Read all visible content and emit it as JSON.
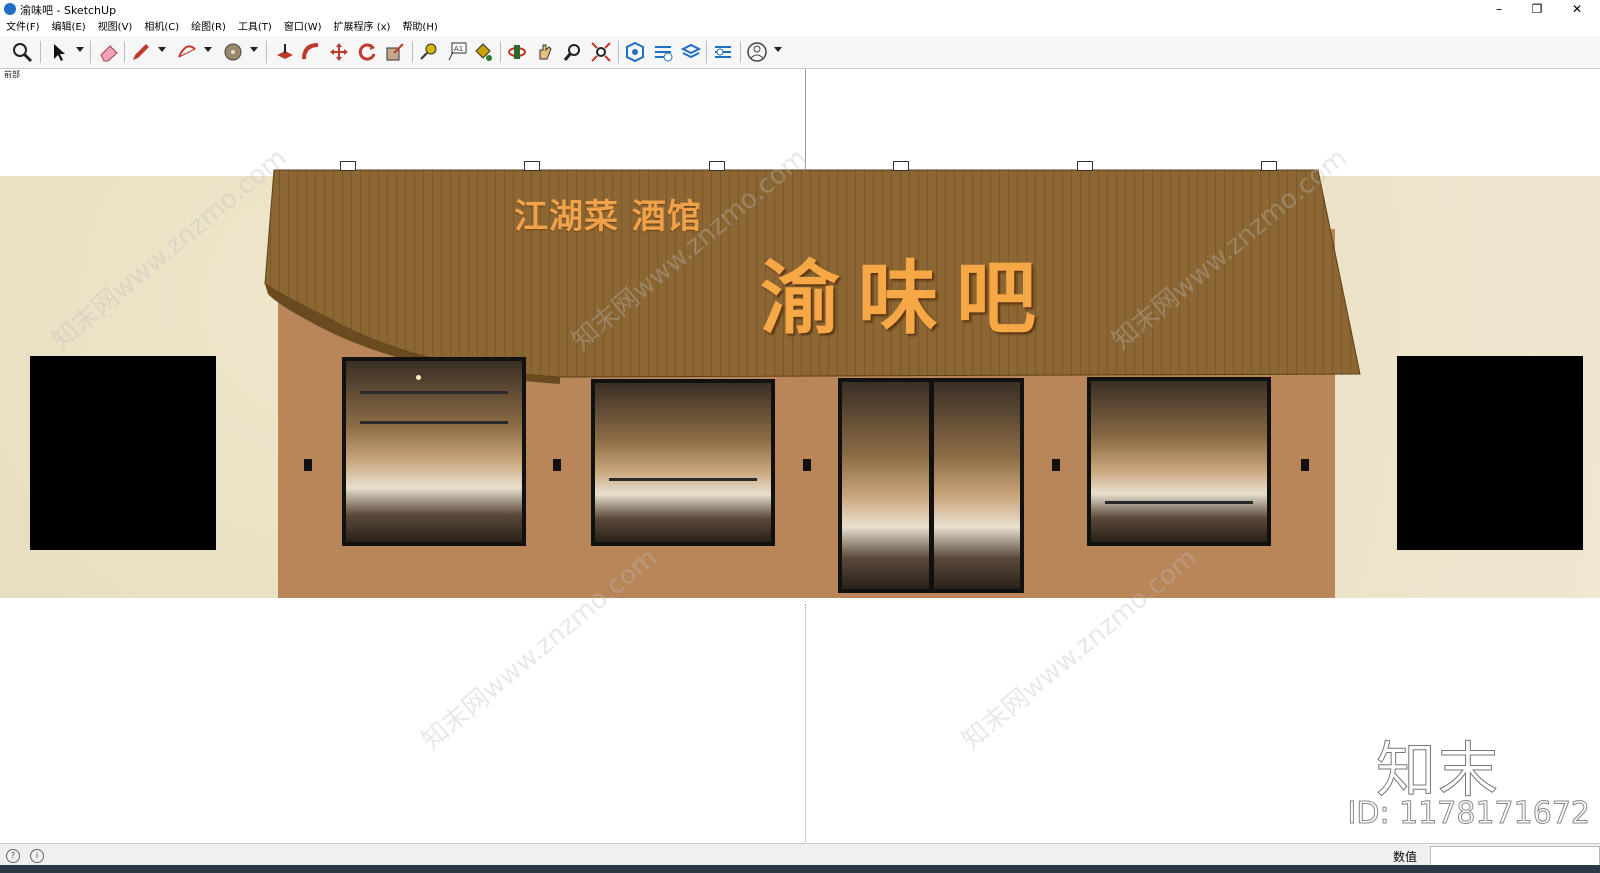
{
  "window": {
    "title": "渝味吧 - SketchUp",
    "minimize": "–",
    "maximize": "❐",
    "close": "✕"
  },
  "menu": [
    {
      "label": "文件(F)"
    },
    {
      "label": "编辑(E)"
    },
    {
      "label": "视图(V)"
    },
    {
      "label": "相机(C)"
    },
    {
      "label": "绘图(R)"
    },
    {
      "label": "工具(T)"
    },
    {
      "label": "窗口(W)"
    },
    {
      "label": "扩展程序 (x)"
    },
    {
      "label": "帮助(H)"
    }
  ],
  "toolbar": {
    "icons": [
      "zoom-icon",
      "select-icon",
      "eraser-icon",
      "pencil-icon",
      "arc-icon",
      "circle-tool-icon",
      "push-pull-icon",
      "follow-me-icon",
      "move-icon",
      "rotate-icon",
      "scale-icon",
      "tape-measure-icon",
      "text-icon",
      "paint-bucket-icon",
      "orbit-icon",
      "pan-icon",
      "zoom-window-icon",
      "zoom-extents-icon",
      "warehouse-icon",
      "extension-warehouse-icon",
      "layout-icon",
      "add-location-icon",
      "account-icon"
    ]
  },
  "viewport": {
    "scene_label": "前部",
    "sign_small": "江湖菜 酒馆",
    "sign_big": "渝味吧",
    "watermark_text": "知末网www.znzmo.com",
    "watermark_logo": "知末",
    "watermark_id": "ID: 1178171672"
  },
  "statusbar": {
    "measurements_label": "数值",
    "measurements_value": ""
  },
  "colors": {
    "roof": "#8a6533",
    "facade": "#b98659",
    "wall": "#ebe1c6",
    "sign": "#f3a445"
  }
}
